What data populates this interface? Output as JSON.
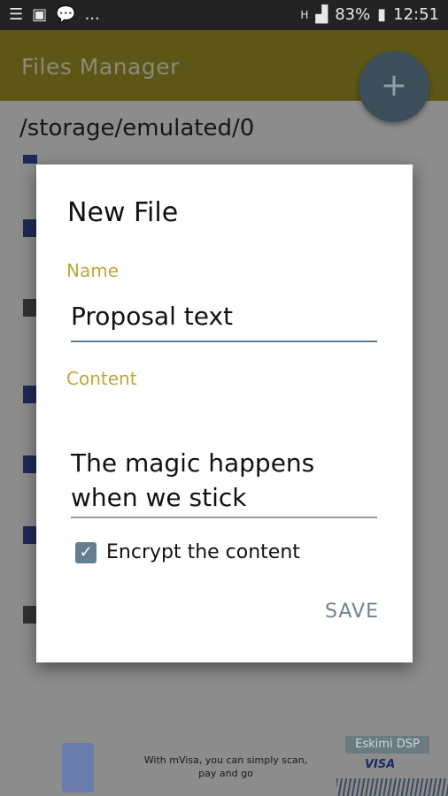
{
  "status_bar": {
    "battery": "83%",
    "time": "12:51",
    "left_more": "..."
  },
  "app": {
    "title": "Files Manager",
    "fab_label": "+"
  },
  "path": "/storage/emulated/0",
  "dialog": {
    "title": "New File",
    "name_label": "Name",
    "name_value": "Proposal text",
    "content_label": "Content",
    "content_value_line1": "The magic happens",
    "content_value_line2": "when we stick",
    "encrypt_label": "Encrypt the content",
    "encrypt_checked": true,
    "save_label": "SAVE"
  },
  "ad": {
    "text_line1": "With mVisa, you can simply scan,",
    "text_line2": "pay and go",
    "brand": "Eskimi DSP",
    "card_brand": "VISA"
  },
  "colors": {
    "accent_label": "#c1a63a",
    "input_active": "#5a7d92",
    "save_text": "#6c8391",
    "checkbox": "#647f8f"
  }
}
